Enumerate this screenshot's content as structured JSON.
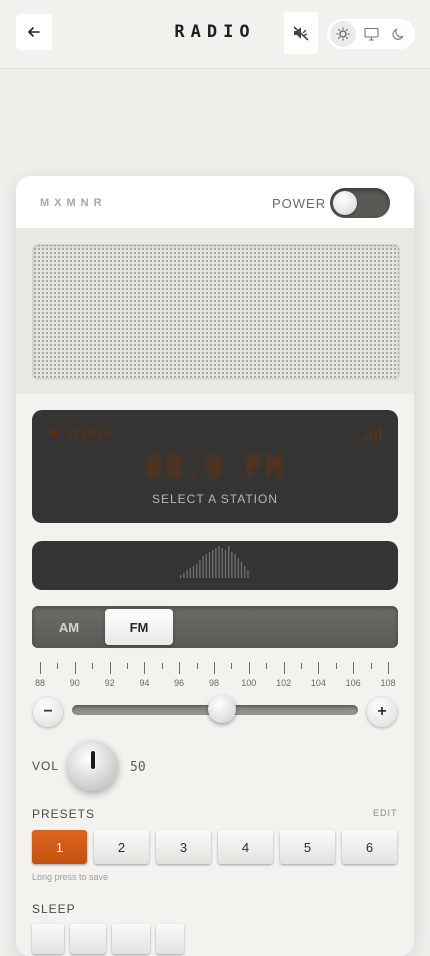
{
  "header": {
    "back_icon": "arrow-left-icon",
    "title": "RADIO",
    "sound_icon": "speaker-muted-icon",
    "theme_options": [
      {
        "id": "light",
        "icon": "sun-icon",
        "active": true
      },
      {
        "id": "system",
        "icon": "monitor-icon",
        "active": false
      },
      {
        "id": "dark",
        "icon": "moon-icon",
        "active": false
      }
    ]
  },
  "radio": {
    "brand": "MXMNR",
    "power_label": "POWER",
    "power_on": false,
    "display": {
      "rds_label": "STEREO",
      "frequency": "88.9 FM",
      "status": "SELECT A STATION"
    },
    "band": {
      "options": [
        "AM",
        "FM"
      ],
      "selected": "FM"
    },
    "dial": {
      "labels": [
        "88",
        "90",
        "92",
        "94",
        "96",
        "98",
        "100",
        "102",
        "104",
        "106",
        "108"
      ],
      "min": 88,
      "max": 108,
      "value": 98.5,
      "down_label": "−",
      "up_label": "+"
    },
    "volume": {
      "label": "VOL",
      "value": "50"
    },
    "presets": {
      "label": "PRESETS",
      "edit_label": "EDIT",
      "items": [
        "1",
        "2",
        "3",
        "4",
        "5",
        "6"
      ],
      "active": "1",
      "hint": "Long press to save"
    },
    "sleep": {
      "label": "SLEEP"
    }
  },
  "colors": {
    "accent": "#d65c17",
    "display_bg": "#353432",
    "page_bg": "#f0efec"
  }
}
